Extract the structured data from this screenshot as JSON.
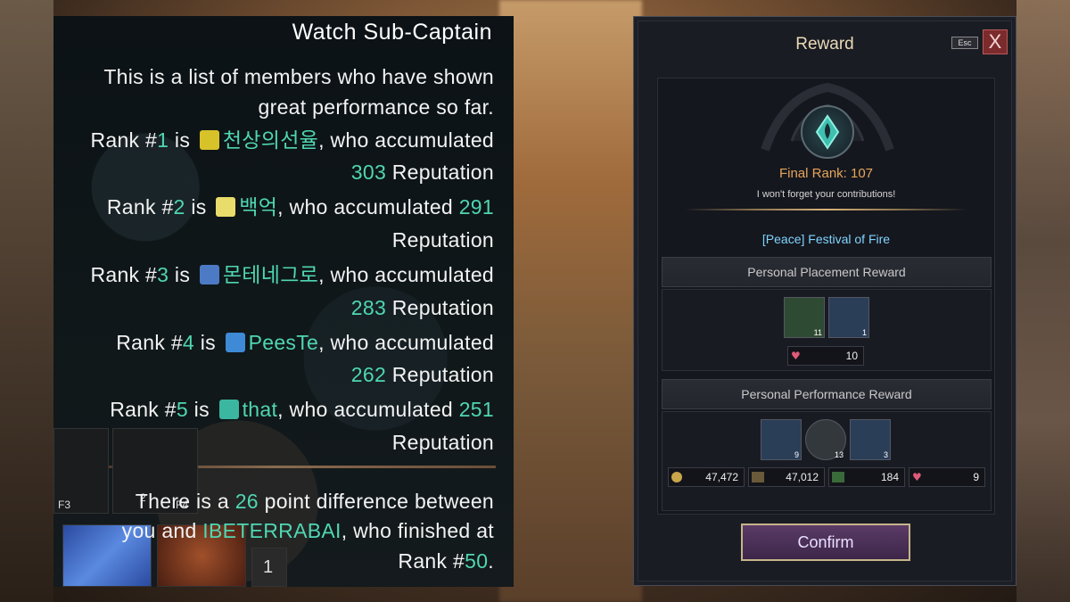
{
  "left_panel": {
    "title": "Watch Sub-Captain",
    "intro_line1": "This is a list of members who have shown",
    "intro_line2": "great performance so far.",
    "ranks": [
      {
        "prefix": "Rank #",
        "num": "1",
        "is": " is ",
        "name": "천상의선율",
        "suffix_a": ", who accumulated",
        "score": "303",
        "suffix_b": " Reputation"
      },
      {
        "prefix": "Rank #",
        "num": "2",
        "is": " is ",
        "name": "백억",
        "suffix_a": ", who accumulated ",
        "score": "291",
        "suffix_b": "Reputation"
      },
      {
        "prefix": "Rank #",
        "num": "3",
        "is": " is ",
        "name": "몬테네그로",
        "suffix_a": ", who accumulated",
        "score": "283",
        "suffix_b": " Reputation"
      },
      {
        "prefix": "Rank #",
        "num": "4",
        "is": " is ",
        "name": "PeesTe",
        "suffix_a": ", who accumulated",
        "score": "262",
        "suffix_b": " Reputation"
      },
      {
        "prefix": "Rank #",
        "num": "5",
        "is": " is ",
        "name": "that",
        "suffix_a": ", who accumulated ",
        "score": "251",
        "suffix_b": "Reputation"
      }
    ],
    "footer_a": "There is a ",
    "footer_points": "26",
    "footer_b": " point difference between",
    "footer_c": "you and ",
    "footer_player": "IBETERRABAI",
    "footer_d": ", who finished at",
    "footer_e": "Rank #",
    "footer_rank": "50",
    "footer_f": ".",
    "slot_labels": [
      "F3",
      "2",
      "F4",
      "1"
    ]
  },
  "reward": {
    "title": "Reward",
    "esc_label": "Esc",
    "close_label": "X",
    "final_rank": "Final Rank: 107",
    "contrib_text": "I won't forget your contributions!",
    "event_name": "[Peace] Festival of Fire",
    "placement_header": "Personal Placement Reward",
    "placement_items": [
      {
        "icon": "chest-icon",
        "count": "11",
        "color": "#2f4a32"
      },
      {
        "icon": "scroll-icon",
        "count": "1",
        "color": "#2a3e58"
      }
    ],
    "placement_currency": {
      "icon": "heart-icon",
      "value": "10"
    },
    "performance_header": "Personal Performance Reward",
    "performance_items": [
      {
        "icon": "scroll-icon",
        "count": "9",
        "color": "#2a3e58"
      },
      {
        "icon": "emblem-icon",
        "count": "13",
        "color": "#33383c"
      },
      {
        "icon": "chest-icon",
        "count": "3",
        "color": "#2a3e58"
      }
    ],
    "performance_currency": [
      {
        "icon": "silver-coin-icon",
        "value": "47,472"
      },
      {
        "icon": "exp-icon",
        "value": "47,012"
      },
      {
        "icon": "exp-green-icon",
        "value": "184"
      },
      {
        "icon": "heart-icon",
        "value": "9"
      }
    ],
    "confirm_label": "Confirm"
  }
}
